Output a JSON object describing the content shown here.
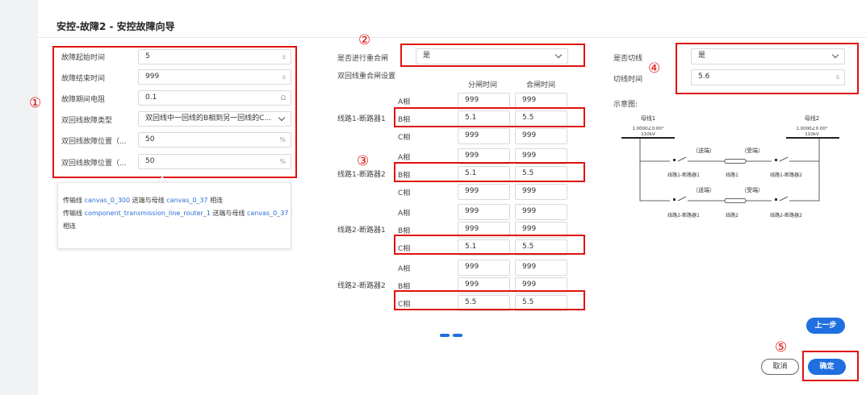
{
  "title": "安控-故障2 - 安控故障向导",
  "annotations": [
    "①",
    "②",
    "③",
    "④",
    "⑤"
  ],
  "left_form": [
    {
      "label": "故障起始时间",
      "value": "5",
      "unit": "s"
    },
    {
      "label": "故障结束时间",
      "value": "999",
      "unit": "s"
    },
    {
      "label": "故障期间电阻",
      "value": "0.1",
      "unit": "Ω"
    },
    {
      "label": "双回线故障类型",
      "value": "双回线中一回线的B相到另一回线的C...",
      "unit": ""
    },
    {
      "label": "双回线故障位置（...",
      "value": "50",
      "unit": "%"
    },
    {
      "label": "双回线故障位置（...",
      "value": "50",
      "unit": "%"
    }
  ],
  "note": {
    "line1_prefix": "传输线 ",
    "line1_link1": "canvas_0_300",
    "line1_mid": " 送端与母线 ",
    "line1_link2": "canvas_0_37",
    "line1_suffix": " 相连",
    "line2_prefix": "传输线 ",
    "line2_link1": "component_transmission_line_router_1",
    "line2_mid": " 送端与母线 ",
    "line2_link2": "canvas_0_37",
    "line2_suffix": " 相连"
  },
  "reclose": {
    "label": "是否进行重合闸",
    "value": "是"
  },
  "reclose_settings": {
    "title": "双回线重合闸设置",
    "col_open": "分闸时间",
    "col_close": "合闸时间",
    "groups": [
      {
        "name": "线路1-断路器1",
        "rows": [
          {
            "phase": "A相",
            "open": "999",
            "close": "999"
          },
          {
            "phase": "B相",
            "open": "5.1",
            "close": "5.5"
          },
          {
            "phase": "C相",
            "open": "999",
            "close": "999"
          }
        ]
      },
      {
        "name": "线路1-断路器2",
        "rows": [
          {
            "phase": "A相",
            "open": "999",
            "close": "999"
          },
          {
            "phase": "B相",
            "open": "5.1",
            "close": "5.5"
          },
          {
            "phase": "C相",
            "open": "999",
            "close": "999"
          }
        ]
      },
      {
        "name": "线路2-断路器1",
        "rows": [
          {
            "phase": "A相",
            "open": "999",
            "close": "999"
          },
          {
            "phase": "B相",
            "open": "999",
            "close": "999"
          },
          {
            "phase": "C相",
            "open": "5.1",
            "close": "5.5"
          }
        ]
      },
      {
        "name": "线路2-断路器2",
        "rows": [
          {
            "phase": "A相",
            "open": "999",
            "close": "999"
          },
          {
            "phase": "B相",
            "open": "999",
            "close": "999"
          },
          {
            "phase": "C相",
            "open": "5.5",
            "close": "5.5"
          }
        ]
      }
    ]
  },
  "cut": {
    "label": "是否切线",
    "value": "是",
    "time_label": "切线时间",
    "time_value": "5.6",
    "time_unit": "s"
  },
  "diagram": {
    "label": "示意图:",
    "bus1": "母线1",
    "bus2": "母线2",
    "bus1_value": "1.0000∠0.00°",
    "bus2_value": "1.0000∠0.00°",
    "bus1_kv": "110kV",
    "bus2_kv": "110kV",
    "send": "（送端）",
    "recv": "（受端）",
    "l1b1": "线路1-断路器1",
    "line1": "线路1",
    "l1b2": "线路1-断路器2",
    "l2b1": "线路2-断路器1",
    "line2": "线路2",
    "l2b2": "线路2-断路器2"
  },
  "buttons": {
    "prev": "上一步",
    "cancel": "取消",
    "ok": "确定"
  }
}
